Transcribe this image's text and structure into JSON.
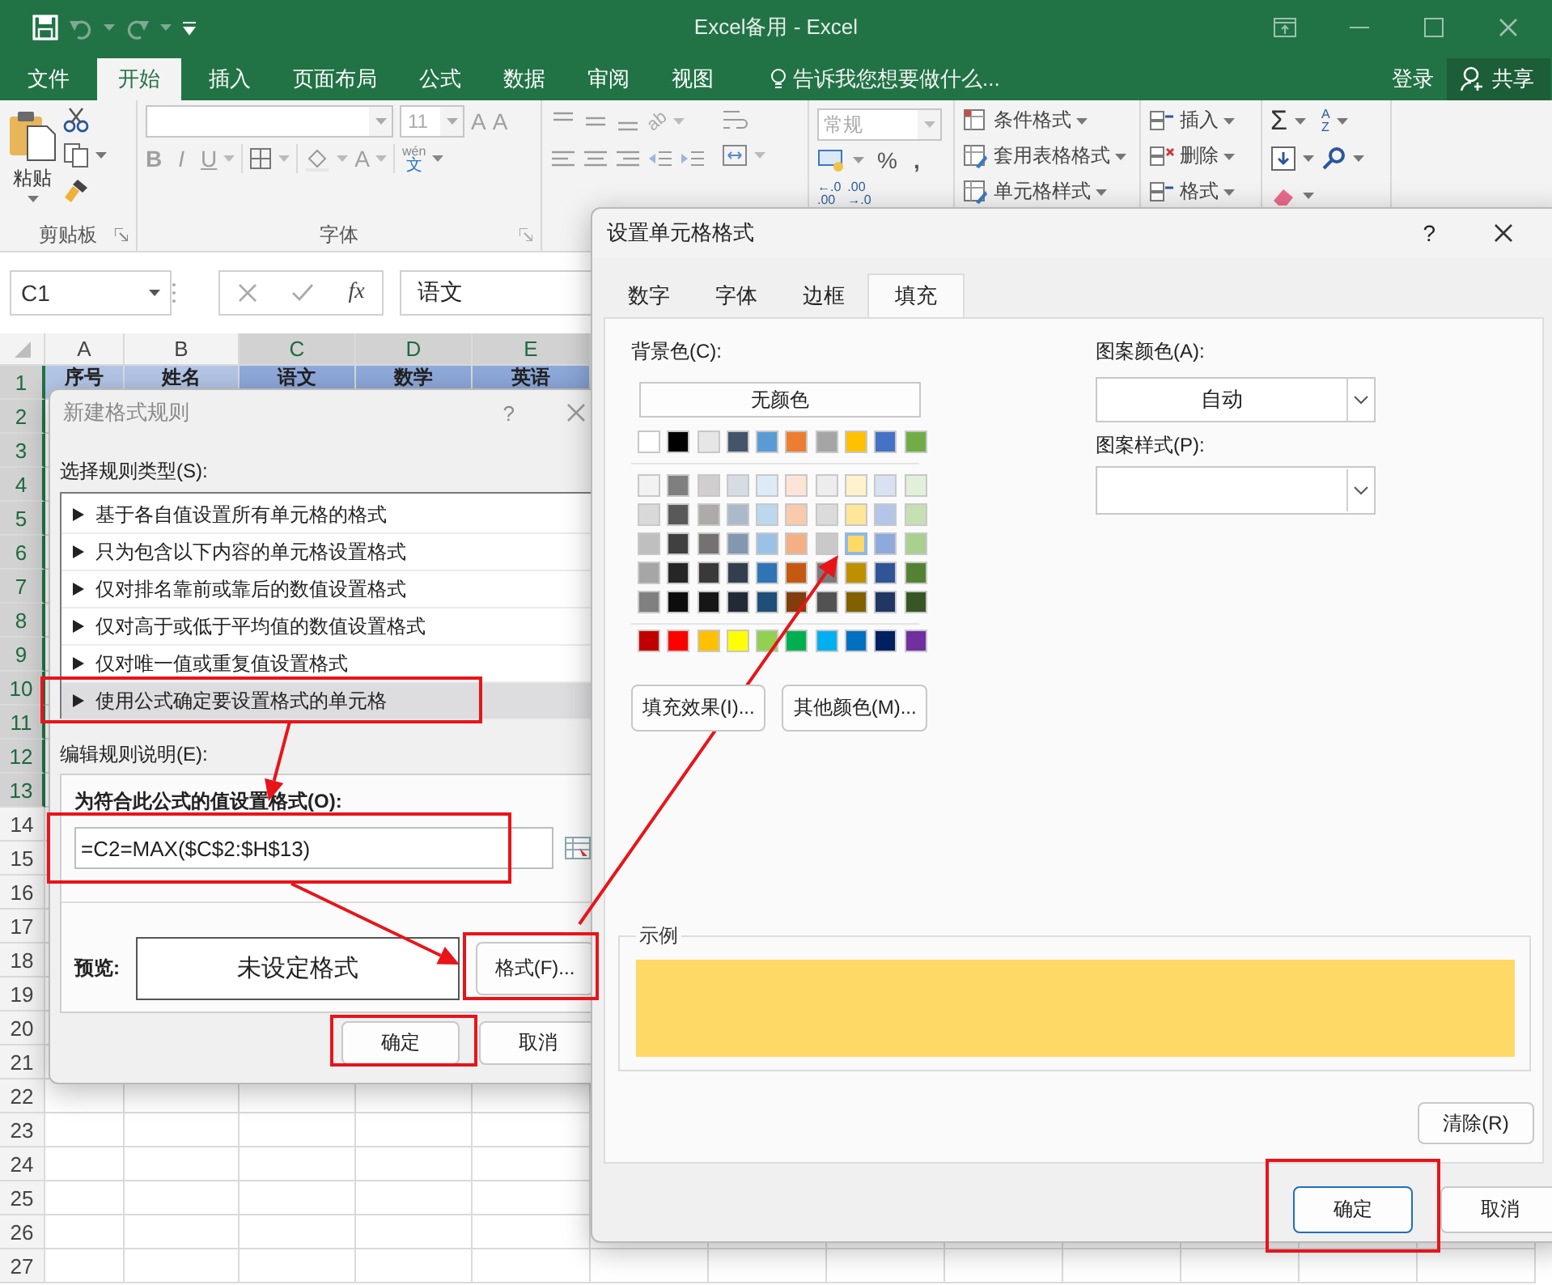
{
  "window": {
    "title": "Excel备用 - Excel"
  },
  "menu_tabs": [
    {
      "label": "文件",
      "selected": false
    },
    {
      "label": "开始",
      "selected": true
    },
    {
      "label": "插入",
      "selected": false
    },
    {
      "label": "页面布局",
      "selected": false
    },
    {
      "label": "公式",
      "selected": false
    },
    {
      "label": "数据",
      "selected": false
    },
    {
      "label": "审阅",
      "selected": false
    },
    {
      "label": "视图",
      "selected": false
    }
  ],
  "tell_me": {
    "placeholder": "告诉我您想要做什么..."
  },
  "sign_in": "登录",
  "share": "共享",
  "ribbon": {
    "clipboard": {
      "paste": "粘贴",
      "label": "剪贴板"
    },
    "font": {
      "font_size": "11",
      "grow": "A",
      "shrink": "A",
      "bold": "B",
      "italic": "I",
      "underline": "U",
      "font_color": "A",
      "phonetic": {
        "top": "wén",
        "bottom": "文"
      },
      "label": "字体"
    },
    "alignment": {
      "orientation": "ab"
    },
    "number": {
      "format": "常规",
      "percent": "%",
      "comma": ",",
      "decimals": [
        {
          "top": "←.0",
          "bottom": ".00"
        },
        {
          "top": ".00",
          "bottom": "→.0"
        }
      ]
    },
    "styles": [
      "条件格式",
      "套用表格格式",
      "单元格样式"
    ],
    "cells": [
      "插入",
      "删除",
      "格式"
    ],
    "editing": {
      "autosum": "Σ",
      "sort": {
        "top": "A",
        "bottom": "Z"
      }
    }
  },
  "formula_bar": {
    "name_box": "C1",
    "function_label": "fx",
    "value": "语文"
  },
  "sheet": {
    "columns": [
      {
        "label": "A",
        "selected": false
      },
      {
        "label": "B",
        "selected": false
      },
      {
        "label": "C",
        "selected": true
      },
      {
        "label": "D",
        "selected": true
      },
      {
        "label": "E",
        "selected": true
      }
    ],
    "rows": [
      {
        "number": "1",
        "selected": true
      },
      {
        "number": "2",
        "selected": true
      },
      {
        "number": "3",
        "selected": true
      },
      {
        "number": "4",
        "selected": true
      },
      {
        "number": "5",
        "selected": true
      },
      {
        "number": "6",
        "selected": true
      },
      {
        "number": "7",
        "selected": true
      },
      {
        "number": "8",
        "selected": true
      },
      {
        "number": "9",
        "selected": true
      },
      {
        "number": "10",
        "selected": true
      },
      {
        "number": "11",
        "selected": true
      },
      {
        "number": "12",
        "selected": true
      },
      {
        "number": "13",
        "selected": true
      },
      {
        "number": "14",
        "selected": false
      },
      {
        "number": "15",
        "selected": false
      },
      {
        "number": "16",
        "selected": false
      },
      {
        "number": "17",
        "selected": false
      },
      {
        "number": "18",
        "selected": false
      },
      {
        "number": "19",
        "selected": false
      },
      {
        "number": "20",
        "selected": false
      },
      {
        "number": "21",
        "selected": false
      },
      {
        "number": "22",
        "selected": false
      },
      {
        "number": "23",
        "selected": false
      },
      {
        "number": "24",
        "selected": false
      },
      {
        "number": "25",
        "selected": false
      },
      {
        "number": "26",
        "selected": false
      },
      {
        "number": "27",
        "selected": false
      }
    ],
    "first_row": [
      {
        "text": "序号",
        "selected": false
      },
      {
        "text": "姓名",
        "selected": false
      },
      {
        "text": "语文",
        "selected": true
      },
      {
        "text": "数学",
        "selected": true
      },
      {
        "text": "英语",
        "selected": true
      }
    ]
  },
  "rule_dialog": {
    "title": "新建格式规则",
    "help": "?",
    "rule_type_label": "选择规则类型(S):",
    "rule_types": [
      {
        "label": "基于各自值设置所有单元格的格式",
        "selected": false
      },
      {
        "label": "只为包含以下内容的单元格设置格式",
        "selected": false
      },
      {
        "label": "仅对排名靠前或靠后的数值设置格式",
        "selected": false
      },
      {
        "label": "仅对高于或低于平均值的数值设置格式",
        "selected": false
      },
      {
        "label": "仅对唯一值或重复值设置格式",
        "selected": false
      },
      {
        "label": "使用公式确定要设置格式的单元格",
        "selected": true
      }
    ],
    "description_label": "编辑规则说明(E):",
    "formula_label": "为符合此公式的值设置格式(O):",
    "formula": "=C2=MAX($C$2:$H$13)",
    "preview_label": "预览:",
    "preview": "未设定格式",
    "format_button": "格式(F)...",
    "buttons": [
      "确定",
      "取消"
    ]
  },
  "format_dialog": {
    "title": "设置单元格格式",
    "help": "?",
    "tabs": [
      {
        "label": "数字",
        "selected": false
      },
      {
        "label": "字体",
        "selected": false
      },
      {
        "label": "边框",
        "selected": false
      },
      {
        "label": "填充",
        "selected": true
      }
    ],
    "background_label": "背景色(C):",
    "no_color": "无颜色",
    "palette": [
      {
        "kind": "theme",
        "swatches": [
          {
            "color": "#ffffff",
            "selected": false
          },
          {
            "color": "#000000",
            "selected": false
          },
          {
            "color": "#e7e6e6",
            "selected": false
          },
          {
            "color": "#44546a",
            "selected": false
          },
          {
            "color": "#5b9bd5",
            "selected": false
          },
          {
            "color": "#ed7d31",
            "selected": false
          },
          {
            "color": "#a5a5a5",
            "selected": false
          },
          {
            "color": "#ffc000",
            "selected": false
          },
          {
            "color": "#4472c4",
            "selected": false
          },
          {
            "color": "#70ad47",
            "selected": false
          }
        ]
      },
      {
        "kind": "tint",
        "swatches": [
          {
            "color": "#f2f2f2",
            "selected": false
          },
          {
            "color": "#7f7f7f",
            "selected": false
          },
          {
            "color": "#d0cece",
            "selected": false
          },
          {
            "color": "#d6dce4",
            "selected": false
          },
          {
            "color": "#ddebf7",
            "selected": false
          },
          {
            "color": "#fce4d6",
            "selected": false
          },
          {
            "color": "#ededed",
            "selected": false
          },
          {
            "color": "#fff2cc",
            "selected": false
          },
          {
            "color": "#d9e1f2",
            "selected": false
          },
          {
            "color": "#e2efda",
            "selected": false
          }
        ]
      },
      {
        "kind": "tint",
        "swatches": [
          {
            "color": "#d9d9d9",
            "selected": false
          },
          {
            "color": "#595959",
            "selected": false
          },
          {
            "color": "#aeaaaa",
            "selected": false
          },
          {
            "color": "#acb9ca",
            "selected": false
          },
          {
            "color": "#bdd7ee",
            "selected": false
          },
          {
            "color": "#f8cbad",
            "selected": false
          },
          {
            "color": "#dbdbdb",
            "selected": false
          },
          {
            "color": "#ffe699",
            "selected": false
          },
          {
            "color": "#b4c6e7",
            "selected": false
          },
          {
            "color": "#c6e0b4",
            "selected": false
          }
        ]
      },
      {
        "kind": "tint",
        "swatches": [
          {
            "color": "#bfbfbf",
            "selected": false
          },
          {
            "color": "#404040",
            "selected": false
          },
          {
            "color": "#757171",
            "selected": false
          },
          {
            "color": "#8497b0",
            "selected": false
          },
          {
            "color": "#9bc2e6",
            "selected": false
          },
          {
            "color": "#f4b084",
            "selected": false
          },
          {
            "color": "#c9c9c9",
            "selected": false
          },
          {
            "color": "#ffd966",
            "selected": true
          },
          {
            "color": "#8ea9db",
            "selected": false
          },
          {
            "color": "#a9d08e",
            "selected": false
          }
        ]
      },
      {
        "kind": "tint",
        "swatches": [
          {
            "color": "#a6a6a6",
            "selected": false
          },
          {
            "color": "#262626",
            "selected": false
          },
          {
            "color": "#3a3838",
            "selected": false
          },
          {
            "color": "#333f4f",
            "selected": false
          },
          {
            "color": "#2f75b5",
            "selected": false
          },
          {
            "color": "#c65911",
            "selected": false
          },
          {
            "color": "#7b7b7b",
            "selected": false
          },
          {
            "color": "#bf8f00",
            "selected": false
          },
          {
            "color": "#305496",
            "selected": false
          },
          {
            "color": "#548235",
            "selected": false
          }
        ]
      },
      {
        "kind": "tint",
        "swatches": [
          {
            "color": "#808080",
            "selected": false
          },
          {
            "color": "#0d0d0d",
            "selected": false
          },
          {
            "color": "#161616",
            "selected": false
          },
          {
            "color": "#222b35",
            "selected": false
          },
          {
            "color": "#1f4e78",
            "selected": false
          },
          {
            "color": "#833c0c",
            "selected": false
          },
          {
            "color": "#525252",
            "selected": false
          },
          {
            "color": "#806000",
            "selected": false
          },
          {
            "color": "#203764",
            "selected": false
          },
          {
            "color": "#375623",
            "selected": false
          }
        ]
      },
      {
        "kind": "standard",
        "swatches": [
          {
            "color": "#c00000",
            "selected": false
          },
          {
            "color": "#ff0000",
            "selected": false
          },
          {
            "color": "#ffc000",
            "selected": false
          },
          {
            "color": "#ffff00",
            "selected": false
          },
          {
            "color": "#92d050",
            "selected": false
          },
          {
            "color": "#00b050",
            "selected": false
          },
          {
            "color": "#00b0f0",
            "selected": false
          },
          {
            "color": "#0070c0",
            "selected": false
          },
          {
            "color": "#002060",
            "selected": false
          },
          {
            "color": "#7030a0",
            "selected": false
          }
        ]
      }
    ],
    "fill_effects": "填充效果(I)...",
    "more_colors": "其他颜色(M)...",
    "pattern_color_label": "图案颜色(A):",
    "pattern_color": "自动",
    "pattern_style_label": "图案样式(P):",
    "sample_label": "示例",
    "clear": "清除(R)",
    "buttons": [
      "确定",
      "取消"
    ]
  }
}
